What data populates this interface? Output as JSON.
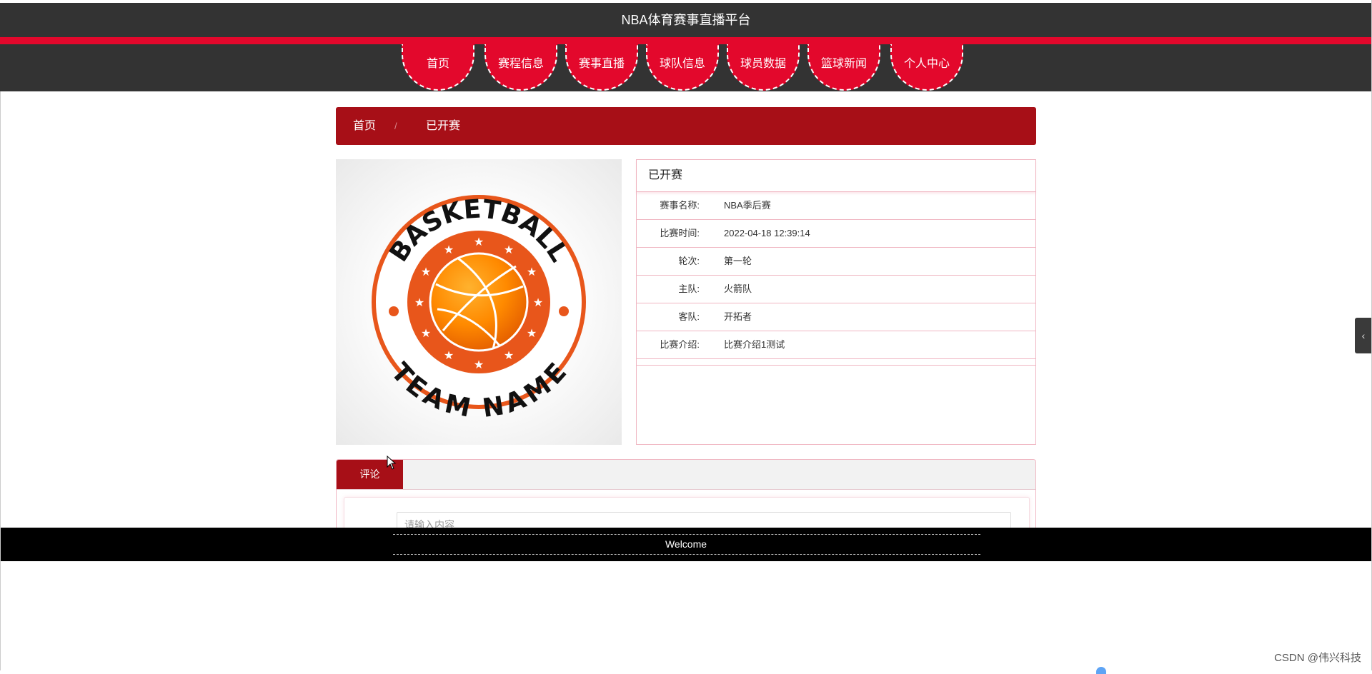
{
  "header": {
    "site_title": "NBA体育赛事直播平台",
    "nav_items": [
      {
        "label": "首页"
      },
      {
        "label": "赛程信息"
      },
      {
        "label": "赛事直播"
      },
      {
        "label": "球队信息"
      },
      {
        "label": "球员数据"
      },
      {
        "label": "篮球新闻"
      },
      {
        "label": "个人中心"
      }
    ],
    "accent_color": "#e3082c",
    "bar_color": "#333333"
  },
  "breadcrumb": {
    "home": "首页",
    "separator": "/",
    "current": "已开赛"
  },
  "logo": {
    "top_text": "BASKETBALL",
    "bottom_text": "TEAM NAME",
    "colors": {
      "ring": "#e8561b",
      "ball": "#ff8a00",
      "text": "#111111"
    }
  },
  "details": {
    "title": "已开赛",
    "rows": [
      {
        "label": "赛事名称:",
        "value": "NBA季后赛"
      },
      {
        "label": "比赛时间:",
        "value": "2022-04-18 12:39:14"
      },
      {
        "label": "轮次:",
        "value": "第一轮"
      },
      {
        "label": "主队:",
        "value": "火箭队"
      },
      {
        "label": "客队:",
        "value": "开拓者"
      },
      {
        "label": "比赛介绍:",
        "value": "比赛介绍1测试"
      }
    ]
  },
  "comments": {
    "tab_label": "评论",
    "input_placeholder": "请输入内容"
  },
  "footer": {
    "text": "Welcome"
  },
  "side_toggle": {
    "icon": "chevron-left-icon",
    "glyph": "‹"
  },
  "watermark": "CSDN @伟兴科技",
  "brand_dark_red": "#a70f17"
}
